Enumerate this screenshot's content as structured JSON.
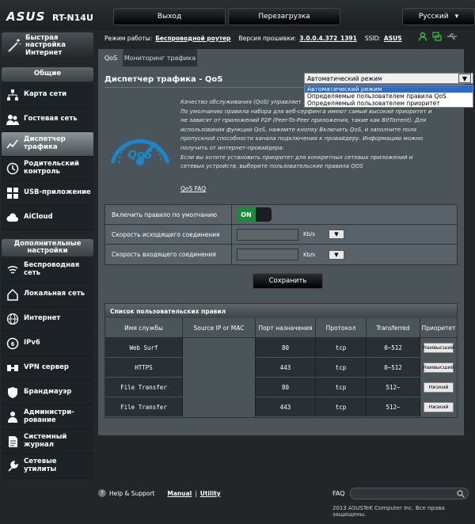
{
  "header": {
    "brand": "ASUS",
    "model": "RT-N14U",
    "logout": "Выход",
    "reboot": "Перезагрузка",
    "language": "Русский"
  },
  "infobar": {
    "mode_label": "Режим работы:",
    "mode_value": "Беспроводной роутер",
    "fw_label": "Версия прошивки:",
    "fw_value": "3.0.0.4.372_1391",
    "ssid_label": "SSID:",
    "ssid_value": "ASUS"
  },
  "sidebar": {
    "quick": "Быстрая настройка Интернет",
    "general": "Общие",
    "general_items": [
      {
        "label": "Карта сети",
        "icon": "network-map-icon"
      },
      {
        "label": "Гостевая сеть",
        "icon": "guest-network-icon"
      },
      {
        "label": "Диспетчер трафика",
        "icon": "traffic-manager-icon"
      },
      {
        "label": "Родительский контроль",
        "icon": "parental-control-icon"
      },
      {
        "label": "USB-приложение",
        "icon": "usb-app-icon"
      },
      {
        "label": "AiCloud",
        "icon": "aicloud-icon"
      }
    ],
    "advanced": "Дополнительные настройки",
    "advanced_items": [
      {
        "label": "Беспроводная сеть",
        "icon": "wireless-icon"
      },
      {
        "label": "Локальная сеть",
        "icon": "lan-icon"
      },
      {
        "label": "Интернет",
        "icon": "internet-icon"
      },
      {
        "label": "IPv6",
        "icon": "ipv6-icon"
      },
      {
        "label": "VPN сервер",
        "icon": "vpn-icon"
      },
      {
        "label": "Брандмауэр",
        "icon": "firewall-icon"
      },
      {
        "label": "Администри-рование",
        "icon": "administration-icon"
      },
      {
        "label": "Системный журнал",
        "icon": "system-log-icon"
      },
      {
        "label": "Сетевые утилиты",
        "icon": "network-tools-icon"
      }
    ]
  },
  "tabs": [
    "QoS",
    "Мониторинг трафика"
  ],
  "page_title": "Диспетчер трафика - QoS",
  "mode_select": {
    "value": "Автоматический режим",
    "options": [
      "Автоматический режим",
      "Определяемые пользователем правила QoS",
      "Определяемый пользователем приоритет"
    ]
  },
  "description": [
    "Качество обслуживания (QoS) управляет ...",
    "По умолчанию правила набора для веб-серфинга имеют самый высокий приоритет и",
    "не зависят от приложений P2P (Peer-To-Peer приложения, такие как BitTorrent). Для",
    "использования функции QoS, нажмите кнопку Включить QoS, и заполните поля",
    "пропускной способности канала подключения к провайдеру. Информацию можно",
    "получить от интернет-провайдера.",
    "Если вы хотите установить приоритет для конкретных сетевых приложений и",
    "сетевых устройств, выберите пользовательские правила QOS"
  ],
  "faq_link": "QoS FAQ",
  "form": {
    "enable_label": "Включить правило по умолчанию",
    "toggle": "ON",
    "upload_label": "Скорость исходящего соединения",
    "download_label": "Скорость входящего соединения",
    "unit": "Kb/s"
  },
  "save": "Сохранить",
  "rules": {
    "title": "Список пользовательских правил",
    "columns": [
      "Имя службы",
      "Source IP or MAC",
      "Порт назначения",
      "Протокол",
      "Transferred",
      "Приоритет"
    ],
    "rows": [
      [
        "Web Surf",
        "",
        "80",
        "tcp",
        "0~512",
        "Наивысший"
      ],
      [
        "HTTPS",
        "",
        "443",
        "tcp",
        "0~512",
        "Наивысший"
      ],
      [
        "File Transfer",
        "",
        "80",
        "tcp",
        "512~",
        "Низкий"
      ],
      [
        "File Transfer",
        "",
        "443",
        "tcp",
        "512~",
        "Низкий"
      ]
    ]
  },
  "footer": {
    "help": "Help & Support",
    "manual": "Manual",
    "utility": "Utility",
    "faq": "FAQ",
    "copyright": "2013 ASUSTeK Computer Inc. Все права защищены."
  }
}
